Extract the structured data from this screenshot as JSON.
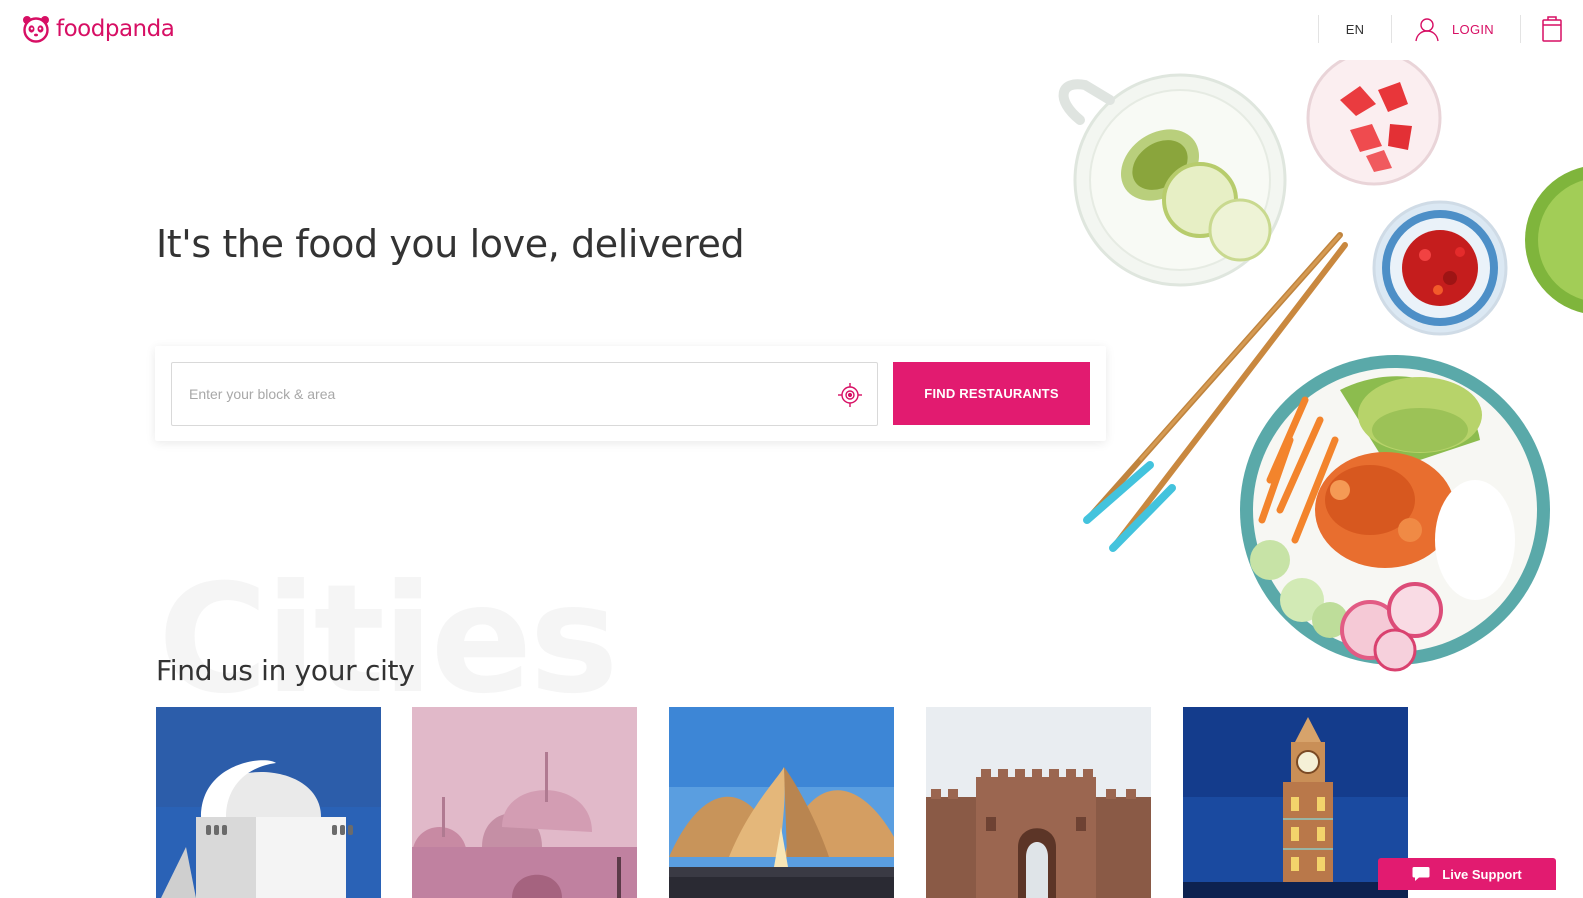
{
  "header": {
    "logo_text": "foodpanda",
    "language": "EN",
    "login_label": "LOGIN"
  },
  "hero": {
    "title": "It's the food you love, delivered",
    "search_placeholder": "Enter your block & area",
    "search_value": "",
    "find_button_label": "FIND RESTAURANTS"
  },
  "cities": {
    "background_word": "Cities",
    "title": "Find us in your city",
    "cards": [
      {
        "icon": "karachi-mausoleum-image"
      },
      {
        "icon": "lahore-mosque-image"
      },
      {
        "icon": "islamabad-monument-image"
      },
      {
        "icon": "fort-gate-image"
      },
      {
        "icon": "clock-tower-image"
      }
    ]
  },
  "live_support": {
    "label": "Live Support"
  },
  "colors": {
    "brand": "#d70f64",
    "button": "#e21b70"
  }
}
